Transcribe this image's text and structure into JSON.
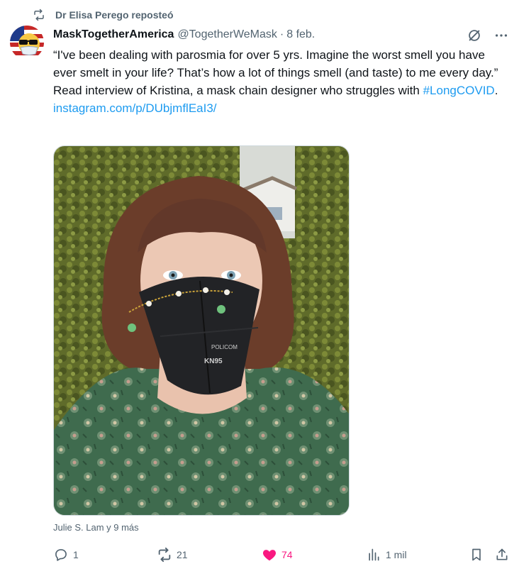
{
  "repost": {
    "label": "Dr Elisa Perego reposteó",
    "icon": "repost-icon"
  },
  "author": {
    "display_name": "MaskTogetherAmerica",
    "handle": "@TogetherWeMask",
    "separator": "·",
    "date": "8 feb."
  },
  "tweet": {
    "text": "“I've been dealing with parosmia for over 5 yrs. Imagine the worst smell you have ever smelt in your life? That’s how a lot of things smell (and taste) to me every day.” Read interview of Kristina, a mask chain designer who struggles with ",
    "hashtag": "#LongCOVID",
    "after_hashtag": ".",
    "link": "instagram.com/p/DUbjmflEaI3/"
  },
  "media": {
    "mask_print_1": "POLICOM",
    "mask_print_2": "KN95"
  },
  "tagged": "Julie S. Lam y 9 más",
  "actions": {
    "reply_count": "1",
    "repost_count": "21",
    "like_count": "74",
    "views_count": "1 mil"
  },
  "colors": {
    "accent": "#1d9bf0",
    "like": "#f91880",
    "muted": "#536471",
    "text": "#0f1419"
  }
}
